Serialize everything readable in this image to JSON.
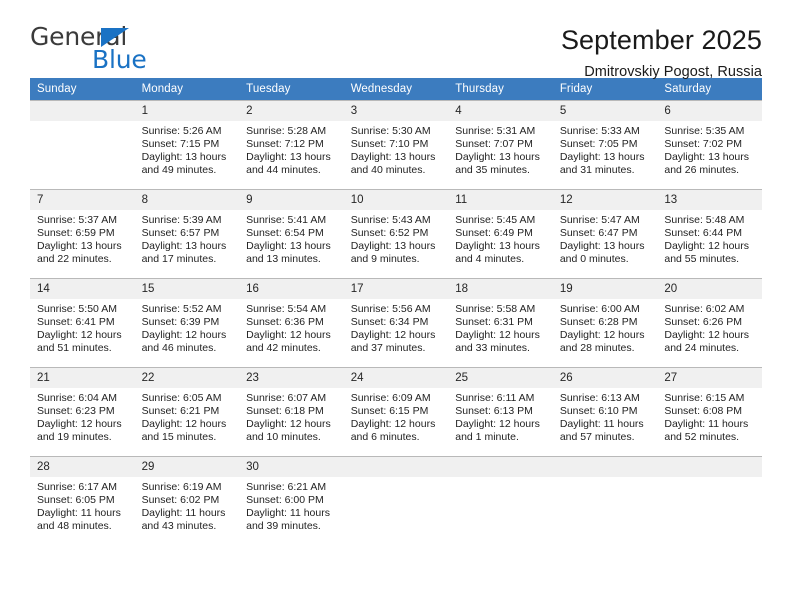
{
  "brand": {
    "name_top": "General",
    "name_bottom": "Blue",
    "accent_color": "#1a72c4"
  },
  "header": {
    "month_title": "September 2025",
    "location": "Dmitrovskiy Pogost, Russia",
    "header_bg_color": "#3c7cbf"
  },
  "calendar": {
    "weekday_headers": [
      "Sunday",
      "Monday",
      "Tuesday",
      "Wednesday",
      "Thursday",
      "Friday",
      "Saturday"
    ],
    "weeks": [
      [
        {
          "day": "",
          "empty": true,
          "sunrise": "",
          "sunset": "",
          "daylight_line1": "",
          "daylight_line2": ""
        },
        {
          "day": "1",
          "empty": false,
          "sunrise": "Sunrise: 5:26 AM",
          "sunset": "Sunset: 7:15 PM",
          "daylight_line1": "Daylight: 13 hours",
          "daylight_line2": "and 49 minutes."
        },
        {
          "day": "2",
          "empty": false,
          "sunrise": "Sunrise: 5:28 AM",
          "sunset": "Sunset: 7:12 PM",
          "daylight_line1": "Daylight: 13 hours",
          "daylight_line2": "and 44 minutes."
        },
        {
          "day": "3",
          "empty": false,
          "sunrise": "Sunrise: 5:30 AM",
          "sunset": "Sunset: 7:10 PM",
          "daylight_line1": "Daylight: 13 hours",
          "daylight_line2": "and 40 minutes."
        },
        {
          "day": "4",
          "empty": false,
          "sunrise": "Sunrise: 5:31 AM",
          "sunset": "Sunset: 7:07 PM",
          "daylight_line1": "Daylight: 13 hours",
          "daylight_line2": "and 35 minutes."
        },
        {
          "day": "5",
          "empty": false,
          "sunrise": "Sunrise: 5:33 AM",
          "sunset": "Sunset: 7:05 PM",
          "daylight_line1": "Daylight: 13 hours",
          "daylight_line2": "and 31 minutes."
        },
        {
          "day": "6",
          "empty": false,
          "sunrise": "Sunrise: 5:35 AM",
          "sunset": "Sunset: 7:02 PM",
          "daylight_line1": "Daylight: 13 hours",
          "daylight_line2": "and 26 minutes."
        }
      ],
      [
        {
          "day": "7",
          "empty": false,
          "sunrise": "Sunrise: 5:37 AM",
          "sunset": "Sunset: 6:59 PM",
          "daylight_line1": "Daylight: 13 hours",
          "daylight_line2": "and 22 minutes."
        },
        {
          "day": "8",
          "empty": false,
          "sunrise": "Sunrise: 5:39 AM",
          "sunset": "Sunset: 6:57 PM",
          "daylight_line1": "Daylight: 13 hours",
          "daylight_line2": "and 17 minutes."
        },
        {
          "day": "9",
          "empty": false,
          "sunrise": "Sunrise: 5:41 AM",
          "sunset": "Sunset: 6:54 PM",
          "daylight_line1": "Daylight: 13 hours",
          "daylight_line2": "and 13 minutes."
        },
        {
          "day": "10",
          "empty": false,
          "sunrise": "Sunrise: 5:43 AM",
          "sunset": "Sunset: 6:52 PM",
          "daylight_line1": "Daylight: 13 hours",
          "daylight_line2": "and 9 minutes."
        },
        {
          "day": "11",
          "empty": false,
          "sunrise": "Sunrise: 5:45 AM",
          "sunset": "Sunset: 6:49 PM",
          "daylight_line1": "Daylight: 13 hours",
          "daylight_line2": "and 4 minutes."
        },
        {
          "day": "12",
          "empty": false,
          "sunrise": "Sunrise: 5:47 AM",
          "sunset": "Sunset: 6:47 PM",
          "daylight_line1": "Daylight: 13 hours",
          "daylight_line2": "and 0 minutes."
        },
        {
          "day": "13",
          "empty": false,
          "sunrise": "Sunrise: 5:48 AM",
          "sunset": "Sunset: 6:44 PM",
          "daylight_line1": "Daylight: 12 hours",
          "daylight_line2": "and 55 minutes."
        }
      ],
      [
        {
          "day": "14",
          "empty": false,
          "sunrise": "Sunrise: 5:50 AM",
          "sunset": "Sunset: 6:41 PM",
          "daylight_line1": "Daylight: 12 hours",
          "daylight_line2": "and 51 minutes."
        },
        {
          "day": "15",
          "empty": false,
          "sunrise": "Sunrise: 5:52 AM",
          "sunset": "Sunset: 6:39 PM",
          "daylight_line1": "Daylight: 12 hours",
          "daylight_line2": "and 46 minutes."
        },
        {
          "day": "16",
          "empty": false,
          "sunrise": "Sunrise: 5:54 AM",
          "sunset": "Sunset: 6:36 PM",
          "daylight_line1": "Daylight: 12 hours",
          "daylight_line2": "and 42 minutes."
        },
        {
          "day": "17",
          "empty": false,
          "sunrise": "Sunrise: 5:56 AM",
          "sunset": "Sunset: 6:34 PM",
          "daylight_line1": "Daylight: 12 hours",
          "daylight_line2": "and 37 minutes."
        },
        {
          "day": "18",
          "empty": false,
          "sunrise": "Sunrise: 5:58 AM",
          "sunset": "Sunset: 6:31 PM",
          "daylight_line1": "Daylight: 12 hours",
          "daylight_line2": "and 33 minutes."
        },
        {
          "day": "19",
          "empty": false,
          "sunrise": "Sunrise: 6:00 AM",
          "sunset": "Sunset: 6:28 PM",
          "daylight_line1": "Daylight: 12 hours",
          "daylight_line2": "and 28 minutes."
        },
        {
          "day": "20",
          "empty": false,
          "sunrise": "Sunrise: 6:02 AM",
          "sunset": "Sunset: 6:26 PM",
          "daylight_line1": "Daylight: 12 hours",
          "daylight_line2": "and 24 minutes."
        }
      ],
      [
        {
          "day": "21",
          "empty": false,
          "sunrise": "Sunrise: 6:04 AM",
          "sunset": "Sunset: 6:23 PM",
          "daylight_line1": "Daylight: 12 hours",
          "daylight_line2": "and 19 minutes."
        },
        {
          "day": "22",
          "empty": false,
          "sunrise": "Sunrise: 6:05 AM",
          "sunset": "Sunset: 6:21 PM",
          "daylight_line1": "Daylight: 12 hours",
          "daylight_line2": "and 15 minutes."
        },
        {
          "day": "23",
          "empty": false,
          "sunrise": "Sunrise: 6:07 AM",
          "sunset": "Sunset: 6:18 PM",
          "daylight_line1": "Daylight: 12 hours",
          "daylight_line2": "and 10 minutes."
        },
        {
          "day": "24",
          "empty": false,
          "sunrise": "Sunrise: 6:09 AM",
          "sunset": "Sunset: 6:15 PM",
          "daylight_line1": "Daylight: 12 hours",
          "daylight_line2": "and 6 minutes."
        },
        {
          "day": "25",
          "empty": false,
          "sunrise": "Sunrise: 6:11 AM",
          "sunset": "Sunset: 6:13 PM",
          "daylight_line1": "Daylight: 12 hours",
          "daylight_line2": "and 1 minute."
        },
        {
          "day": "26",
          "empty": false,
          "sunrise": "Sunrise: 6:13 AM",
          "sunset": "Sunset: 6:10 PM",
          "daylight_line1": "Daylight: 11 hours",
          "daylight_line2": "and 57 minutes."
        },
        {
          "day": "27",
          "empty": false,
          "sunrise": "Sunrise: 6:15 AM",
          "sunset": "Sunset: 6:08 PM",
          "daylight_line1": "Daylight: 11 hours",
          "daylight_line2": "and 52 minutes."
        }
      ],
      [
        {
          "day": "28",
          "empty": false,
          "sunrise": "Sunrise: 6:17 AM",
          "sunset": "Sunset: 6:05 PM",
          "daylight_line1": "Daylight: 11 hours",
          "daylight_line2": "and 48 minutes."
        },
        {
          "day": "29",
          "empty": false,
          "sunrise": "Sunrise: 6:19 AM",
          "sunset": "Sunset: 6:02 PM",
          "daylight_line1": "Daylight: 11 hours",
          "daylight_line2": "and 43 minutes."
        },
        {
          "day": "30",
          "empty": false,
          "sunrise": "Sunrise: 6:21 AM",
          "sunset": "Sunset: 6:00 PM",
          "daylight_line1": "Daylight: 11 hours",
          "daylight_line2": "and 39 minutes."
        },
        {
          "day": "",
          "empty": true,
          "sunrise": "",
          "sunset": "",
          "daylight_line1": "",
          "daylight_line2": ""
        },
        {
          "day": "",
          "empty": true,
          "sunrise": "",
          "sunset": "",
          "daylight_line1": "",
          "daylight_line2": ""
        },
        {
          "day": "",
          "empty": true,
          "sunrise": "",
          "sunset": "",
          "daylight_line1": "",
          "daylight_line2": ""
        },
        {
          "day": "",
          "empty": true,
          "sunrise": "",
          "sunset": "",
          "daylight_line1": "",
          "daylight_line2": ""
        }
      ]
    ]
  }
}
